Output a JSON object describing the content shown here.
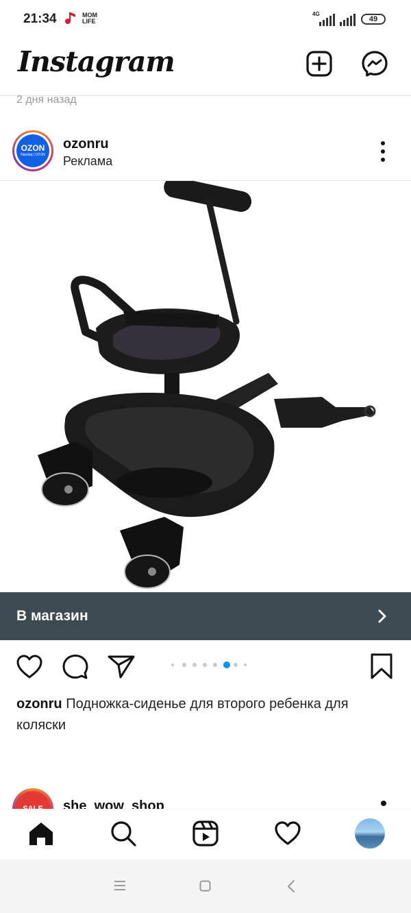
{
  "status_bar": {
    "time": "21:34",
    "notification_badge": "MOM\nLIFE",
    "network_label": "4G",
    "battery": "49"
  },
  "header": {
    "logo_text": "Instagram",
    "new_post_icon": "plus-square-icon",
    "messenger_icon": "messenger-icon"
  },
  "previous_post": {
    "timestamp": "2 дня назад"
  },
  "post": {
    "avatar_text": "OZON",
    "avatar_subtext": "Nasdaq | OZON",
    "username": "ozonru",
    "sponsored_label": "Реклама",
    "image_subject": "stroller board with seat",
    "cta_label": "В магазин",
    "caption_user": "ozonru",
    "caption_text": " Подножка-сиденье для второго ребенка для коляски",
    "carousel": {
      "count": 8,
      "active_index": 5
    }
  },
  "next_post": {
    "avatar_text": "SALE",
    "username": "she_wow_shop"
  },
  "bottom_nav": {
    "items": [
      "home-icon",
      "search-icon",
      "reels-icon",
      "heart-icon",
      "profile-avatar"
    ]
  },
  "colors": {
    "cta_background": "#3d4a52",
    "carousel_active": "#0095f6",
    "ozon_blue": "#1160e6"
  }
}
